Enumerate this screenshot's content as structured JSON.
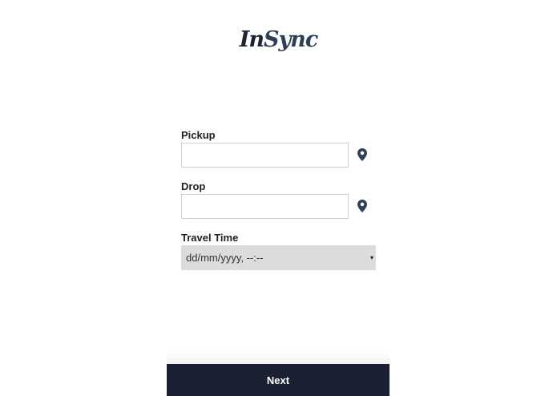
{
  "app": {
    "logo_part1": "In",
    "logo_part2": "Sync"
  },
  "form": {
    "pickup": {
      "label": "Pickup",
      "value": "",
      "icon": "location-pin-icon"
    },
    "drop": {
      "label": "Drop",
      "value": "",
      "icon": "location-pin-icon"
    },
    "travel_time": {
      "label": "Travel Time",
      "value": "dd/mm/yyyy, --:--",
      "caret": "▾"
    }
  },
  "footer": {
    "next_label": "Next"
  },
  "colors": {
    "logo_dark": "#1f2533",
    "logo_accent": "#2f3f57",
    "pin": "#2f3f57",
    "select_bg": "#dcdcdc",
    "button_bg": "#1c2033",
    "button_text": "#ffffff"
  }
}
